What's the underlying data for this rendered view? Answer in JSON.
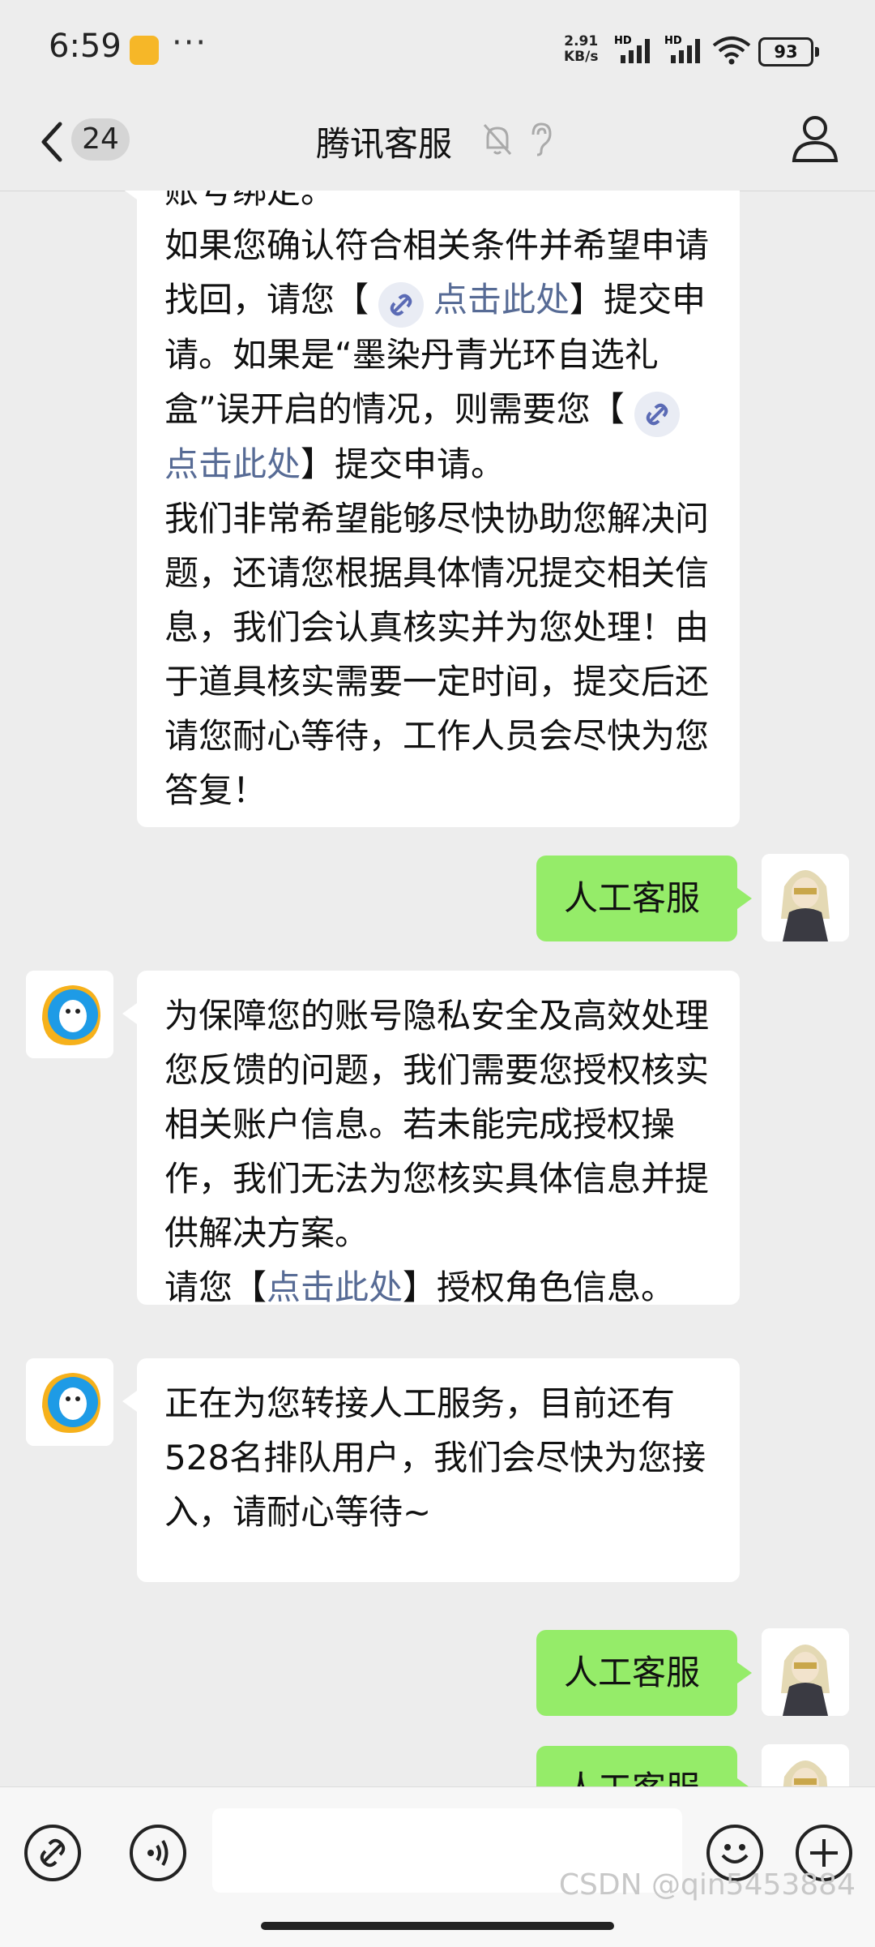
{
  "status_bar": {
    "time": "6:59",
    "more": "···",
    "speed_value": "2.91",
    "speed_unit": "KB/s",
    "net1": "HD",
    "net2": "HD",
    "battery": "93"
  },
  "header": {
    "unread_count": "24",
    "title": "腾讯客服"
  },
  "messages": [
    {
      "from": "service",
      "lines": [
        "账号绑定。",
        "如果您确认符合相关条件并希望申请找回，请您【",
        "点击此处",
        "】提交申请。如果是“墨染丹青光环自选礼盒”误开启的情况，则需要您【",
        "点击此处",
        "】提交申请。",
        "我们非常希望能够尽快协助您解决问题，还请您根据具体情况提交相关信息，我们会认真核实并为您处理！由于道具核实需要一定时间，提交后还请您耐心等待，工作人员会尽快为您答复！"
      ]
    },
    {
      "from": "me",
      "text": "人工客服"
    },
    {
      "from": "service",
      "text": "为保障您的账号隐私安全及高效处理您反馈的问题，我们需要您授权核实相关账户信息。若未能完成授权操作，我们无法为您核实具体信息并提供解决方案。",
      "prefix": "请您【",
      "link": "点击此处",
      "suffix": "】授权角色信息。"
    },
    {
      "from": "service",
      "text": "正在为您转接人工服务，目前还有528名排队用户，我们会尽快为您接入，请耐心等待~"
    },
    {
      "from": "me",
      "text": "人工客服"
    },
    {
      "from": "me",
      "text": "人工客服"
    }
  ],
  "input_bar": {
    "watermark": "CSDN @qin5453884"
  },
  "colors": {
    "background": "#ededed",
    "my_bubble": "#95ec69",
    "link": "#576b95"
  }
}
